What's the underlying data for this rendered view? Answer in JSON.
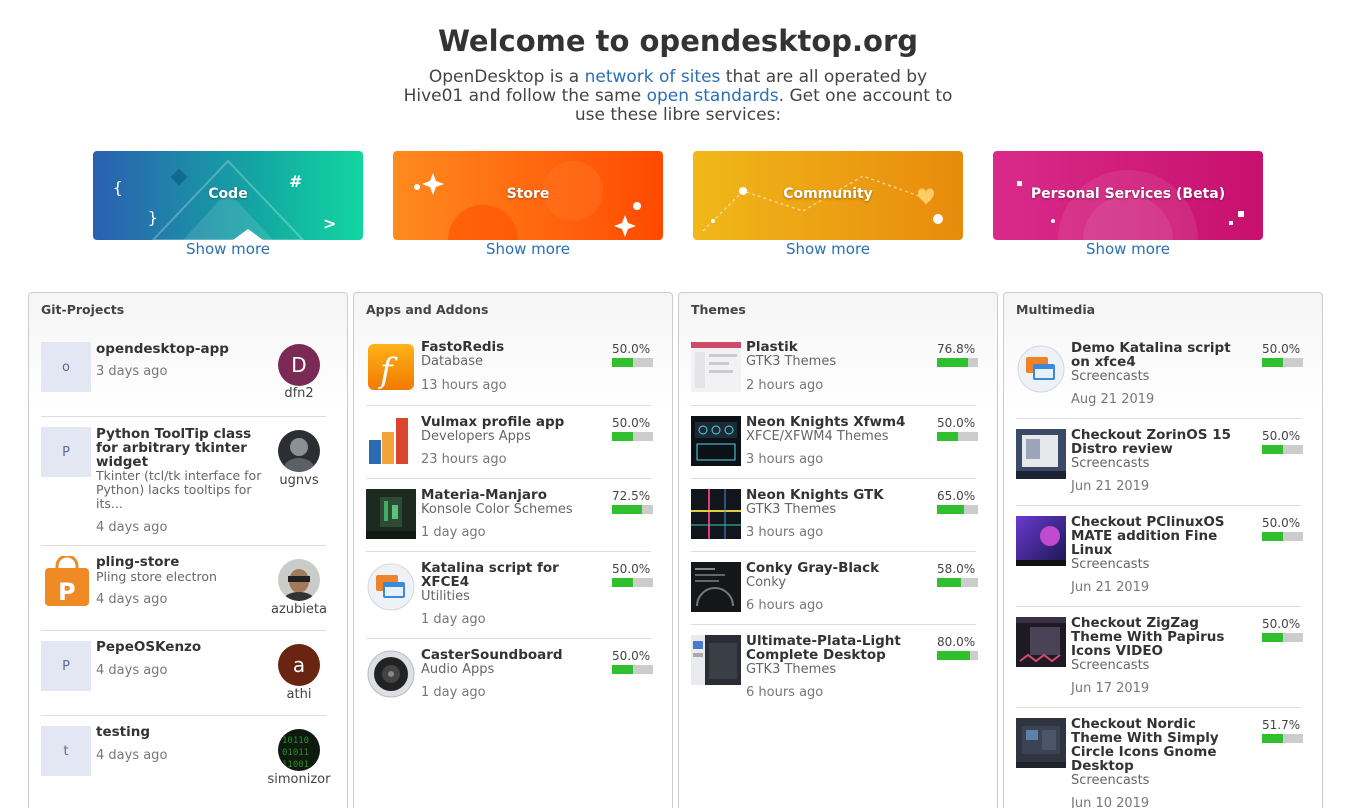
{
  "header": {
    "title": "Welcome to opendesktop.org",
    "intro": {
      "t1": "OpenDesktop is a ",
      "link1": "network of sites",
      "t2": " that are all operated by Hive01 and follow the same ",
      "link2": "open standards",
      "t3": ". Get one account to use these libre services:"
    }
  },
  "cards": [
    {
      "label": "Code",
      "show_more": "Show more"
    },
    {
      "label": "Store",
      "show_more": "Show more"
    },
    {
      "label": "Community",
      "show_more": "Show more"
    },
    {
      "label": "Personal Services (Beta)",
      "show_more": "Show more"
    }
  ],
  "git_projects": {
    "title": "Git-Projects",
    "items": [
      {
        "letter": "o",
        "title": "opendesktop-app",
        "time": "3 days ago",
        "user": "dfn2",
        "avatar_letter": "D"
      },
      {
        "letter": "P",
        "title": "Python ToolTip class for arbitrary tkinter widget",
        "desc": "Tkinter (tcl/tk interface for Python) lacks tooltips for its...",
        "time": "4 days ago",
        "user": "ugnvs"
      },
      {
        "title": "pling-store",
        "desc": "Pling store electron",
        "time": "4 days ago",
        "user": "azubieta"
      },
      {
        "letter": "P",
        "title": "PepeOSKenzo",
        "time": "4 days ago",
        "user": "athi",
        "avatar_letter": "a"
      },
      {
        "letter": "t",
        "title": "testing",
        "time": "4 days ago",
        "user": "simonizor"
      }
    ]
  },
  "apps": {
    "title": "Apps and Addons",
    "items": [
      {
        "title": "FastoRedis",
        "category": "Database",
        "time": "13 hours ago",
        "rating": 50.0,
        "rating_text": "50.0%"
      },
      {
        "title": "Vulmax profile app",
        "category": "Developers Apps",
        "time": "23 hours ago",
        "rating": 50.0,
        "rating_text": "50.0%"
      },
      {
        "title": "Materia-Manjaro",
        "category": "Konsole Color Schemes",
        "time": "1 day ago",
        "rating": 72.5,
        "rating_text": "72.5%"
      },
      {
        "title": "Katalina script for XFCE4",
        "category": "Utilities",
        "time": "1 day ago",
        "rating": 50.0,
        "rating_text": "50.0%"
      },
      {
        "title": "CasterSoundboard",
        "category": "Audio Apps",
        "time": "1 day ago",
        "rating": 50.0,
        "rating_text": "50.0%"
      }
    ]
  },
  "themes": {
    "title": "Themes",
    "items": [
      {
        "title": "Plastik",
        "category": "GTK3 Themes",
        "time": "2 hours ago",
        "rating": 76.8,
        "rating_text": "76.8%"
      },
      {
        "title": "Neon Knights Xfwm4",
        "category": "XFCE/XFWM4 Themes",
        "time": "3 hours ago",
        "rating": 50.0,
        "rating_text": "50.0%"
      },
      {
        "title": "Neon Knights GTK",
        "category": "GTK3 Themes",
        "time": "3 hours ago",
        "rating": 65.0,
        "rating_text": "65.0%"
      },
      {
        "title": "Conky Gray-Black",
        "category": "Conky",
        "time": "6 hours ago",
        "rating": 58.0,
        "rating_text": "58.0%"
      },
      {
        "title": "Ultimate-Plata-Light Complete Desktop",
        "category": "GTK3 Themes",
        "time": "6 hours ago",
        "rating": 80.0,
        "rating_text": "80.0%"
      }
    ]
  },
  "multimedia": {
    "title": "Multimedia",
    "items": [
      {
        "title": "Demo Katalina script on xfce4",
        "category": "Screencasts",
        "time": "Aug 21 2019",
        "rating": 50.0,
        "rating_text": "50.0%"
      },
      {
        "title": "Checkout ZorinOS 15 Distro review",
        "category": "Screencasts",
        "time": "Jun 21 2019",
        "rating": 50.0,
        "rating_text": "50.0%"
      },
      {
        "title": "Checkout PClinuxOS MATE addition Fine Linux",
        "category": "Screencasts",
        "time": "Jun 21 2019",
        "rating": 50.0,
        "rating_text": "50.0%"
      },
      {
        "title": "Checkout ZigZag Theme With Papirus Icons VIDEO",
        "category": "Screencasts",
        "time": "Jun 17 2019",
        "rating": 50.0,
        "rating_text": "50.0%"
      },
      {
        "title": "Checkout Nordic Theme With Simply Circle Icons Gnome Desktop",
        "category": "Screencasts",
        "time": "Jun 10 2019",
        "rating": 51.7,
        "rating_text": "51.7%"
      }
    ]
  }
}
